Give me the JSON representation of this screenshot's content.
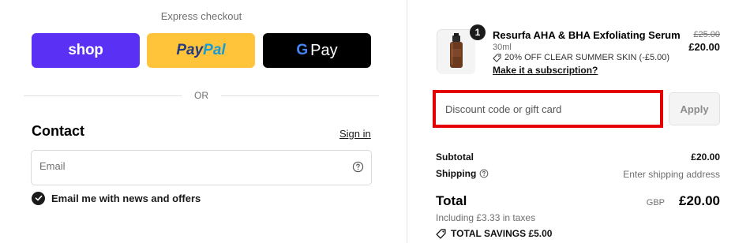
{
  "express": {
    "title": "Express checkout",
    "shop_label": "shop",
    "paypal_part1": "Pay",
    "paypal_part2": "Pal",
    "gpay_g": "G",
    "gpay_label": "Pay"
  },
  "or_text": "OR",
  "contact": {
    "title": "Contact",
    "sign_in": "Sign in",
    "email_placeholder": "Email",
    "news_label": "Email me with news and offers"
  },
  "product": {
    "quantity": "1",
    "name": "Resurfa AHA & BHA Exfoliating Serum",
    "variant": "30ml",
    "discount": "20% OFF CLEAR SUMMER SKIN (-£5.00)",
    "subscription_link": "Make it a subscription?",
    "original_price": "£25.00",
    "price": "£20.00"
  },
  "discount_field": {
    "placeholder": "Discount code or gift card",
    "apply_label": "Apply"
  },
  "summary": {
    "subtotal_label": "Subtotal",
    "subtotal_value": "£20.00",
    "shipping_label": "Shipping",
    "shipping_value": "Enter shipping address",
    "total_label": "Total",
    "currency": "GBP",
    "total_value": "£20.00",
    "taxes": "Including £3.33 in taxes",
    "savings": "TOTAL SAVINGS £5.00"
  },
  "colors": {
    "shop": "#5a31f4",
    "paypal": "#ffc439",
    "gpay": "#000000",
    "highlight": "#e40000"
  }
}
